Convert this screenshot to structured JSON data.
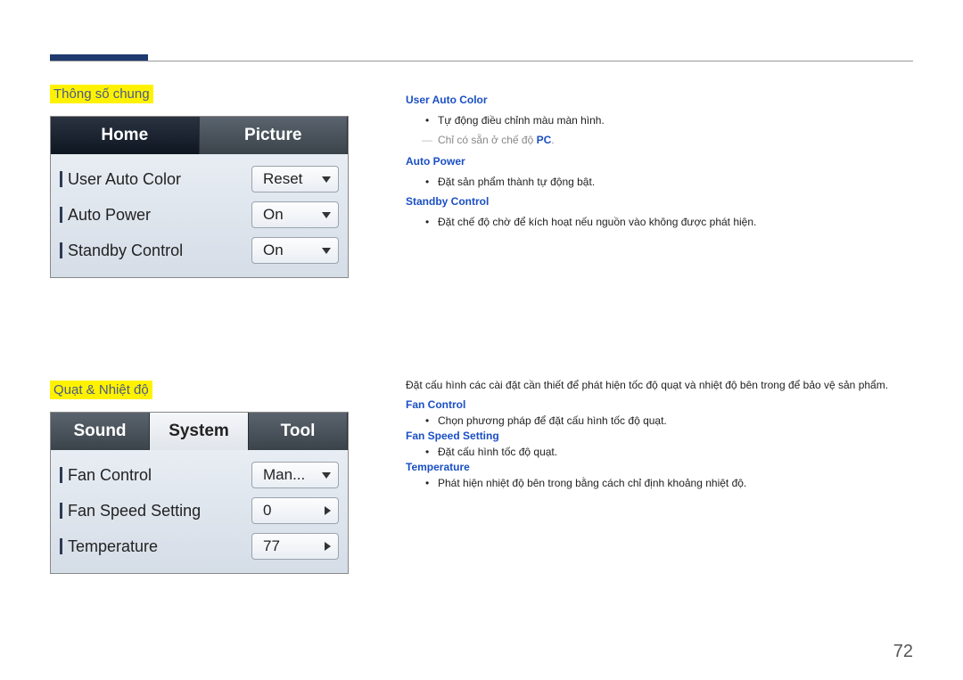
{
  "header": {
    "page_number": "72"
  },
  "section1": {
    "title": "Thông số chung",
    "tabs": {
      "left": "Home",
      "right": "Picture"
    },
    "rows": [
      {
        "label": "User Auto Color",
        "value": "Reset"
      },
      {
        "label": "Auto Power",
        "value": "On"
      },
      {
        "label": "Standby Control",
        "value": "On"
      }
    ],
    "items": [
      {
        "head": "User Auto Color",
        "bullet": "Tự động điều chỉnh màu màn hình.",
        "note_prefix": "Chỉ có sẵn ở chế độ ",
        "note_pc": "PC"
      },
      {
        "head": "Auto Power",
        "bullet": "Đặt sản phẩm thành tự động bật."
      },
      {
        "head": "Standby Control",
        "bullet": "Đặt chế độ chờ để kích hoạt nếu nguồn vào không được phát hiện."
      }
    ]
  },
  "section2": {
    "title": "Quạt & Nhiệt độ",
    "tabs": {
      "left": "Sound",
      "mid": "System",
      "right": "Tool"
    },
    "rows": [
      {
        "label": "Fan Control",
        "value": "Man..."
      },
      {
        "label": "Fan Speed Setting",
        "value": "0"
      },
      {
        "label": "Temperature",
        "value": "77"
      }
    ],
    "intro": "Đặt cấu hình các cài đặt cần thiết để phát hiện tốc độ quạt và nhiệt độ bên trong để bảo vệ sản phẩm.",
    "items": [
      {
        "head": "Fan Control",
        "bullet": "Chọn phương pháp để đặt cấu hình tốc độ quạt."
      },
      {
        "head": "Fan Speed Setting",
        "bullet": "Đặt cấu hình tốc độ quạt."
      },
      {
        "head": "Temperature",
        "bullet": "Phát hiện nhiệt độ bên trong bằng cách chỉ định khoảng nhiệt độ."
      }
    ]
  }
}
